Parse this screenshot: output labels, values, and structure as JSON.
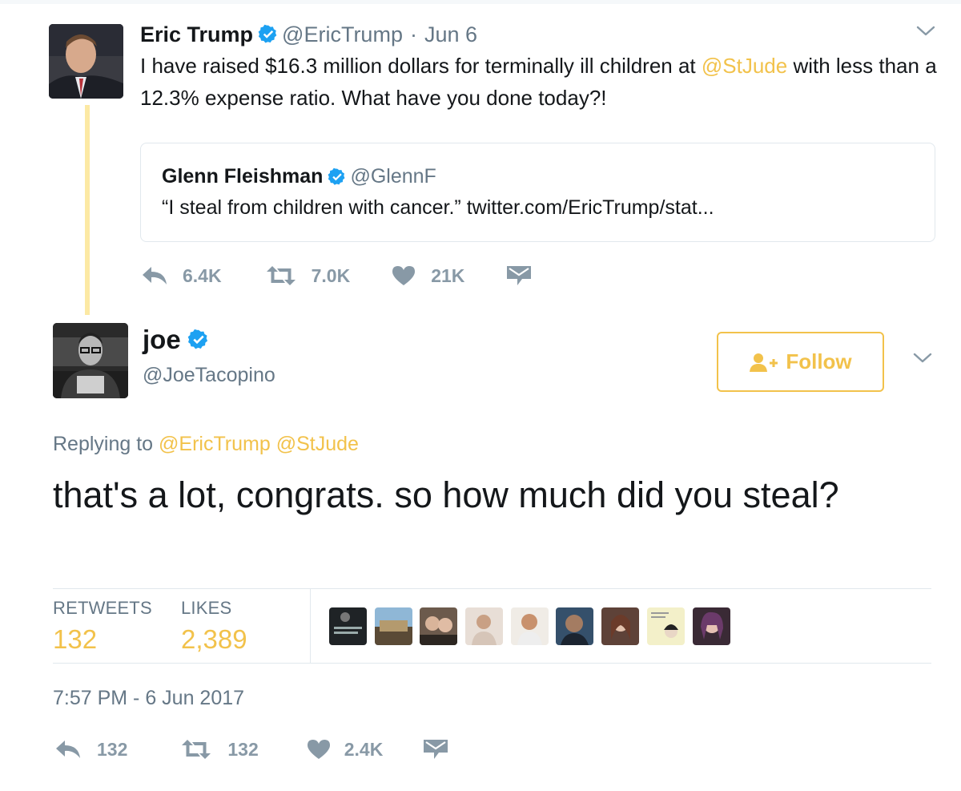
{
  "parent_tweet": {
    "author_name": "Eric Trump",
    "handle": "@EricTrump",
    "separator": "·",
    "date": "Jun 6",
    "text_before": "I have raised $16.3 million dollars for terminally ill children at ",
    "mention": "@StJude",
    "text_after": " with less than a 12.3% expense ratio. What have you done today?!",
    "quote": {
      "author_name": "Glenn Fleishman",
      "handle": "@GlennF",
      "text": "“I steal from children with cancer.” twitter.com/EricTrump/stat..."
    },
    "actions": {
      "reply_count": "6.4K",
      "retweet_count": "7.0K",
      "like_count": "21K"
    }
  },
  "main_tweet": {
    "author_name": "joe",
    "handle": "@JoeTacopino",
    "follow_label": "Follow",
    "replying_label": "Replying to",
    "replying_to": [
      "@EricTrump",
      "@StJude"
    ],
    "text": "that's a lot, congrats. so how much did you steal?",
    "stats": {
      "retweets_label": "RETWEETS",
      "retweets_value": "132",
      "likes_label": "LIKES",
      "likes_value": "2,389"
    },
    "timestamp": "7:57 PM - 6 Jun 2017",
    "actions": {
      "reply_count": "132",
      "retweet_count": "132",
      "like_count": "2.4K"
    }
  },
  "colors": {
    "accent": "#f2c24b",
    "verified": "#1da1f2",
    "muted": "#657786",
    "icon": "#8899a6",
    "thread_line": "#fce9a4"
  },
  "icons": [
    "verified-badge-icon",
    "chevron-down-icon",
    "reply-icon",
    "retweet-icon",
    "heart-icon",
    "direct-message-icon",
    "follow-person-icon"
  ]
}
